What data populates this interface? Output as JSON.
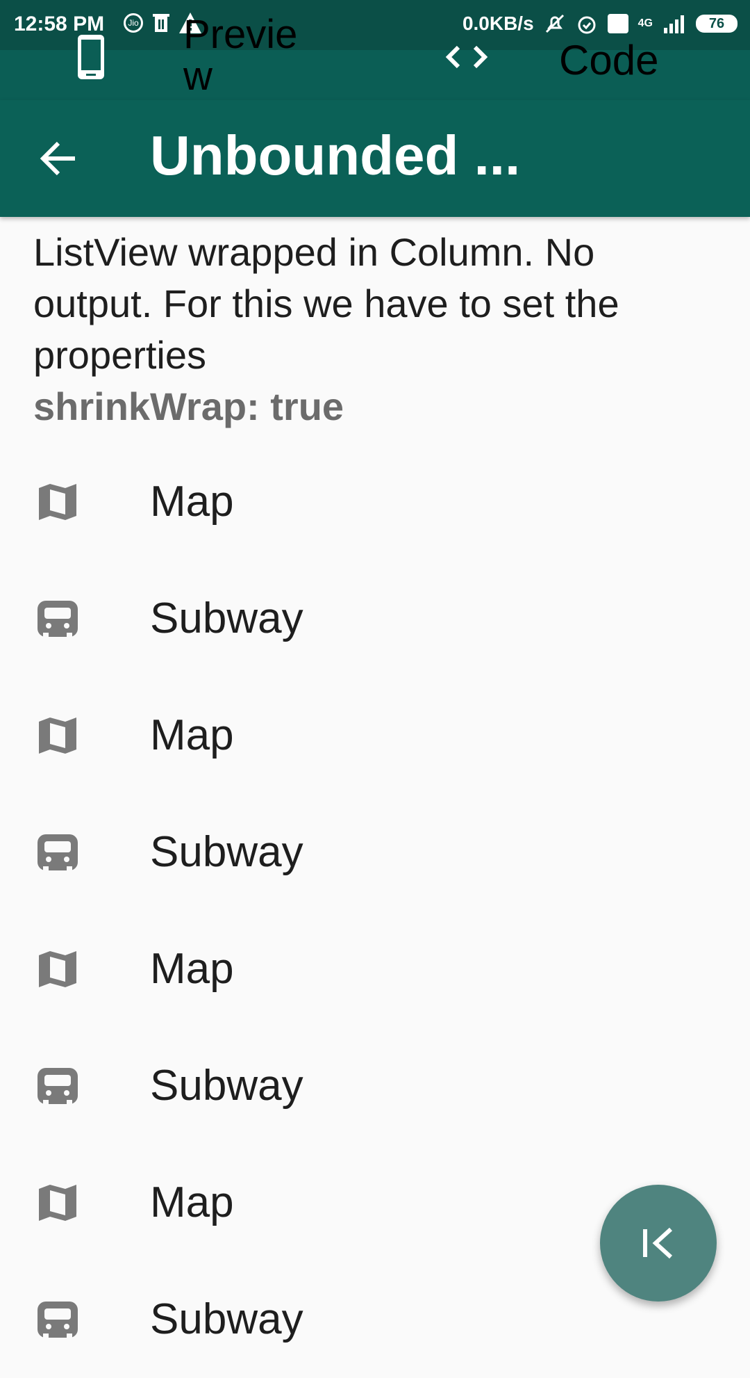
{
  "status_bar": {
    "time": "12:58 PM",
    "carrier_badge": "Jio",
    "network_speed": "0.0KB/s",
    "network_type": "4G",
    "battery_level": "76"
  },
  "preview_tabs": {
    "preview_label": "Previe\nw",
    "code_label": "Code"
  },
  "app_bar": {
    "title": "Unbounded ..."
  },
  "description": {
    "text": "ListView wrapped in Column. No output. For this we have to set the properties",
    "code": "shrinkWrap: true"
  },
  "list_items": [
    {
      "label": "Map",
      "icon": "map-icon"
    },
    {
      "label": "Subway",
      "icon": "subway-icon"
    },
    {
      "label": "Map",
      "icon": "map-icon"
    },
    {
      "label": "Subway",
      "icon": "subway-icon"
    },
    {
      "label": "Map",
      "icon": "map-icon"
    },
    {
      "label": "Subway",
      "icon": "subway-icon"
    },
    {
      "label": "Map",
      "icon": "map-icon"
    },
    {
      "label": "Subway",
      "icon": "subway-icon"
    }
  ],
  "colors": {
    "status_bar": "#0b4f47",
    "app_bar": "#0b6157",
    "fab": "#4f847f",
    "icon_gray": "#7a7a7a"
  }
}
